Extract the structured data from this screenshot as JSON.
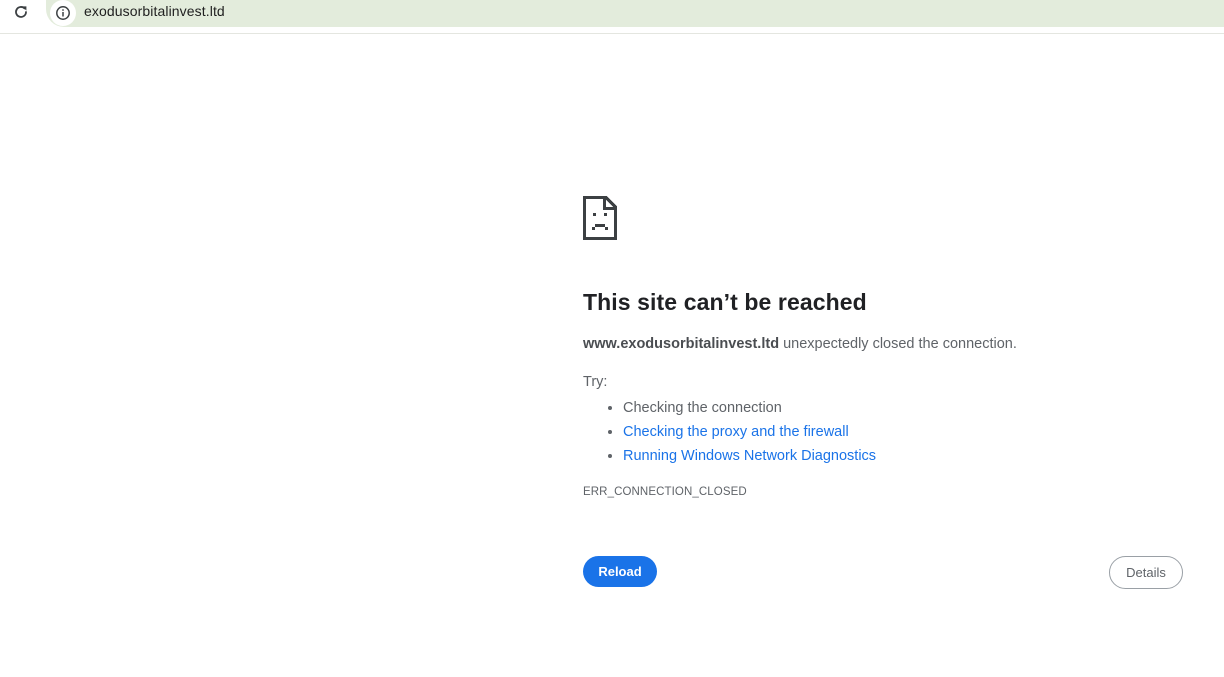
{
  "browser": {
    "url": "exodusorbitalinvest.ltd",
    "icons": {
      "reload": "reload-icon",
      "site_info": "info-icon"
    }
  },
  "error_page": {
    "icon": "sad-page-icon",
    "title": "This site can’t be reached",
    "host": "www.exodusorbitalinvest.ltd",
    "message": " unexpectedly closed the connection.",
    "try_label": "Try:",
    "suggestions": [
      "Checking the connection",
      "Checking the proxy and the firewall",
      "Running Windows Network Diagnostics"
    ],
    "error_code": "ERR_CONNECTION_CLOSED",
    "reload_label": "Reload",
    "details_label": "Details"
  },
  "colors": {
    "accent": "#1a73e8",
    "omnibox_bg": "#e3ecdc",
    "text_primary": "#202124",
    "text_secondary": "#5f6368"
  }
}
